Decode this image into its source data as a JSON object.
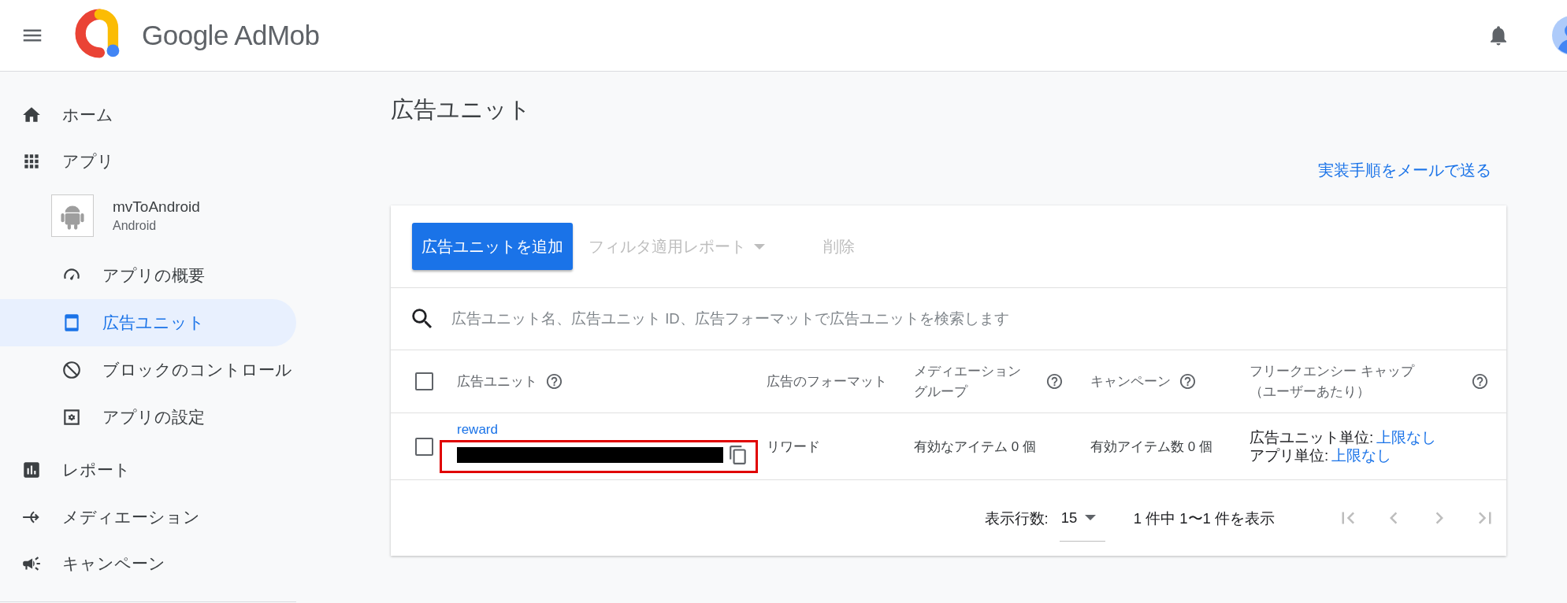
{
  "header": {
    "brand": "Google AdMob"
  },
  "sidebar": {
    "items": [
      {
        "kind": "nav",
        "label": "ホーム",
        "selected": false
      },
      {
        "kind": "nav",
        "label": "アプリ",
        "selected": false
      },
      {
        "kind": "app",
        "name": "mvToAndroid",
        "platform": "Android",
        "children": [
          {
            "label": "アプリの概要",
            "selected": false
          },
          {
            "label": "広告ユニット",
            "selected": true
          },
          {
            "label": "ブロックのコントロール",
            "selected": false
          },
          {
            "label": "アプリの設定",
            "selected": false
          }
        ]
      },
      {
        "kind": "nav",
        "label": "レポート",
        "selected": false
      },
      {
        "kind": "nav",
        "label": "メディエーション",
        "selected": false
      },
      {
        "kind": "nav",
        "label": "キャンペーン",
        "selected": false
      }
    ]
  },
  "page": {
    "title": "広告ユニット",
    "email_link": "実装手順をメールで送る"
  },
  "toolbar": {
    "buttons": [
      {
        "kind": "primary",
        "label": "広告ユニットを追加",
        "disabled": false
      },
      {
        "kind": "dropdown",
        "label": "フィルタ適用レポート",
        "disabled": true
      },
      {
        "kind": "text",
        "label": "削除",
        "disabled": true
      }
    ]
  },
  "search": {
    "placeholder": "広告ユニット名、広告ユニット ID、広告フォーマットで広告ユニットを検索します"
  },
  "table": {
    "select_all": {
      "checked": false
    },
    "columns": [
      {
        "lines": [
          "広告ユニット"
        ],
        "help": true
      },
      {
        "lines": [
          "広告のフォーマット"
        ],
        "help": false
      },
      {
        "lines": [
          "メディエーション",
          "グループ"
        ],
        "help": true
      },
      {
        "lines": [
          "キャンペーン"
        ],
        "help": true
      },
      {
        "lines": [
          "フリークエンシー キャップ",
          "（ユーザーあたり）"
        ],
        "help": true
      }
    ],
    "rows": [
      {
        "checked": false,
        "name": "reward",
        "id_redacted": true,
        "highlighted": true,
        "format": "リワード",
        "mediation": "有効なアイテム 0 個",
        "campaign": "有効アイテム数 0 個",
        "frequency": [
          {
            "label": "広告ユニット単位:",
            "value": "上限なし"
          },
          {
            "label": "アプリ単位:",
            "value": "上限なし"
          }
        ]
      }
    ]
  },
  "pagination": {
    "rows_label": "表示行数:",
    "rows_value": "15",
    "range": "1 件中 1〜1 件を表示"
  }
}
